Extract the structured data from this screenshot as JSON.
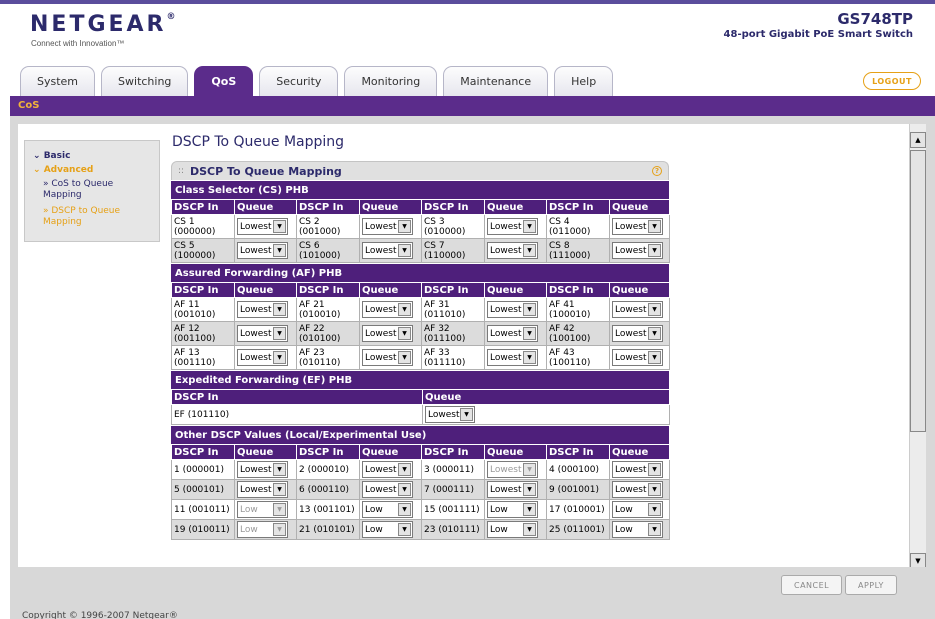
{
  "brand": {
    "logo": "NETGEAR",
    "tagline": "Connect with Innovation™",
    "model": "GS748TP",
    "model_desc": "48-port Gigabit PoE Smart Switch"
  },
  "tabs": [
    {
      "label": "System",
      "active": false
    },
    {
      "label": "Switching",
      "active": false
    },
    {
      "label": "QoS",
      "active": true
    },
    {
      "label": "Security",
      "active": false
    },
    {
      "label": "Monitoring",
      "active": false
    },
    {
      "label": "Maintenance",
      "active": false
    },
    {
      "label": "Help",
      "active": false
    }
  ],
  "logout_label": "LOGOUT",
  "subnav": "CoS",
  "sidenav": {
    "basic": "Basic",
    "advanced": "Advanced",
    "items": [
      "» CoS to Queue Mapping",
      "» DSCP to Queue Mapping"
    ]
  },
  "page_title": "DSCP To Queue Mapping",
  "panel_title": "DSCP To Queue Mapping",
  "help_icon": "?",
  "col_dscp": "DSCP In",
  "col_queue": "Queue",
  "sections": {
    "cs": "Class Selector (CS) PHB",
    "af": "Assured Forwarding (AF) PHB",
    "ef": "Expedited Forwarding (EF) PHB",
    "other": "Other DSCP Values (Local/Experimental Use)"
  },
  "cs_rows": [
    [
      {
        "d": "CS 1",
        "b": "(000000)",
        "q": "Lowest"
      },
      {
        "d": "CS 2",
        "b": "(001000)",
        "q": "Lowest"
      },
      {
        "d": "CS 3",
        "b": "(010000)",
        "q": "Lowest"
      },
      {
        "d": "CS 4",
        "b": "(011000)",
        "q": "Lowest"
      }
    ],
    [
      {
        "d": "CS 5",
        "b": "(100000)",
        "q": "Lowest"
      },
      {
        "d": "CS 6",
        "b": "(101000)",
        "q": "Lowest"
      },
      {
        "d": "CS 7",
        "b": "(110000)",
        "q": "Lowest"
      },
      {
        "d": "CS 8",
        "b": "(111000)",
        "q": "Lowest"
      }
    ]
  ],
  "af_rows": [
    [
      {
        "d": "AF 11",
        "b": "(001010)",
        "q": "Lowest"
      },
      {
        "d": "AF 21",
        "b": "(010010)",
        "q": "Lowest"
      },
      {
        "d": "AF 31",
        "b": "(011010)",
        "q": "Lowest"
      },
      {
        "d": "AF 41",
        "b": "(100010)",
        "q": "Lowest"
      }
    ],
    [
      {
        "d": "AF 12",
        "b": "(001100)",
        "q": "Lowest"
      },
      {
        "d": "AF 22",
        "b": "(010100)",
        "q": "Lowest"
      },
      {
        "d": "AF 32",
        "b": "(011100)",
        "q": "Lowest"
      },
      {
        "d": "AF 42",
        "b": "(100100)",
        "q": "Lowest"
      }
    ],
    [
      {
        "d": "AF 13",
        "b": "(001110)",
        "q": "Lowest"
      },
      {
        "d": "AF 23",
        "b": "(010110)",
        "q": "Lowest"
      },
      {
        "d": "AF 33",
        "b": "(011110)",
        "q": "Lowest"
      },
      {
        "d": "AF 43",
        "b": "(100110)",
        "q": "Lowest"
      }
    ]
  ],
  "ef_row": {
    "d": "EF (101110)",
    "q": "Lowest"
  },
  "other_rows": [
    [
      {
        "d": "1 (000001)",
        "q": "Lowest",
        "dis": false
      },
      {
        "d": "2 (000010)",
        "q": "Lowest",
        "dis": false
      },
      {
        "d": "3 (000011)",
        "q": "Lowest",
        "dis": true
      },
      {
        "d": "4 (000100)",
        "q": "Lowest",
        "dis": false
      }
    ],
    [
      {
        "d": "5 (000101)",
        "q": "Lowest",
        "dis": false
      },
      {
        "d": "6 (000110)",
        "q": "Lowest",
        "dis": false
      },
      {
        "d": "7 (000111)",
        "q": "Lowest",
        "dis": false
      },
      {
        "d": "9 (001001)",
        "q": "Lowest",
        "dis": false
      }
    ],
    [
      {
        "d": "11 (001011)",
        "q": "Low",
        "dis": true
      },
      {
        "d": "13 (001101)",
        "q": "Low",
        "dis": false
      },
      {
        "d": "15 (001111)",
        "q": "Low",
        "dis": false
      },
      {
        "d": "17 (010001)",
        "q": "Low",
        "dis": false
      }
    ],
    [
      {
        "d": "19 (010011)",
        "q": "Low",
        "dis": true
      },
      {
        "d": "21 (010101)",
        "q": "Low",
        "dis": false
      },
      {
        "d": "23 (010111)",
        "q": "Low",
        "dis": false
      },
      {
        "d": "25 (011001)",
        "q": "Low",
        "dis": false
      }
    ]
  ],
  "buttons": {
    "cancel": "CANCEL",
    "apply": "APPLY"
  },
  "copyright": "Copyright © 1996-2007 Netgear®",
  "colors": {
    "purple": "#4e1f7b",
    "accent": "#e6a117",
    "navy": "#2c2a6b"
  }
}
